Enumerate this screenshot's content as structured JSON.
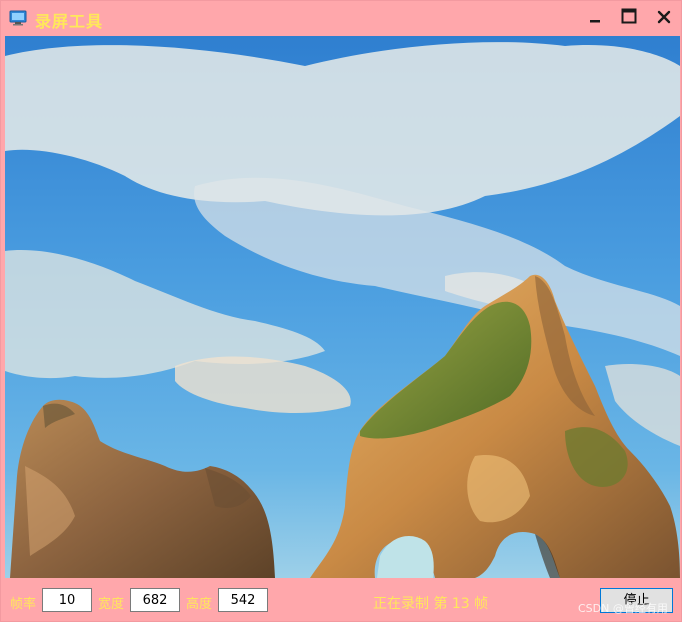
{
  "window": {
    "title": "录屏工具",
    "icons": {
      "app": "monitor-icon",
      "minimize": "minimize-icon",
      "maximize": "maximize-icon",
      "close": "close-icon"
    },
    "colors": {
      "background": "#ffa7ab",
      "label_text": "#ffe85a"
    }
  },
  "capture_preview": {
    "description_icon": "screen-capture-preview"
  },
  "controls": {
    "fps_label": "帧率",
    "fps_value": "10",
    "width_label": "宽度",
    "width_value": "682",
    "height_label": "高度",
    "height_value": "542",
    "status_text": "正在录制 第 13 帧",
    "stop_label": "停止",
    "watermark": "CSDN @曾经有用"
  }
}
